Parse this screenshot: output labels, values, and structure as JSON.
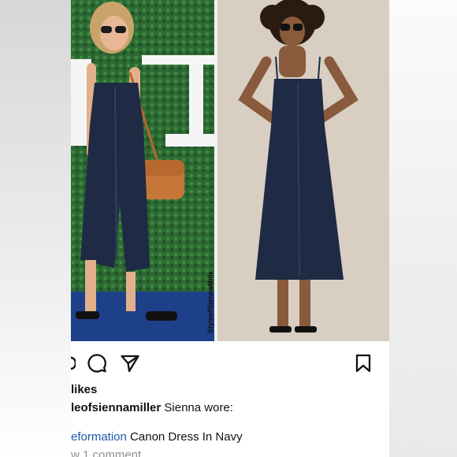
{
  "watermark_text": "StyleofSiennaMiller",
  "post": {
    "likes_label": "likes",
    "caption_user": "leofsiennamiller",
    "caption_text": "Sienna wore:",
    "tag_text": "eformation",
    "product_text": "Canon Dress In Navy",
    "view_comments": "w 1 comment"
  },
  "icons": {
    "comment": "comment-icon",
    "share": "share-icon",
    "save": "bookmark-icon"
  },
  "colors": {
    "tag_link": "#1f57a6",
    "muted_text": "#8e8e8e",
    "dress_navy": "#1f2a44"
  }
}
